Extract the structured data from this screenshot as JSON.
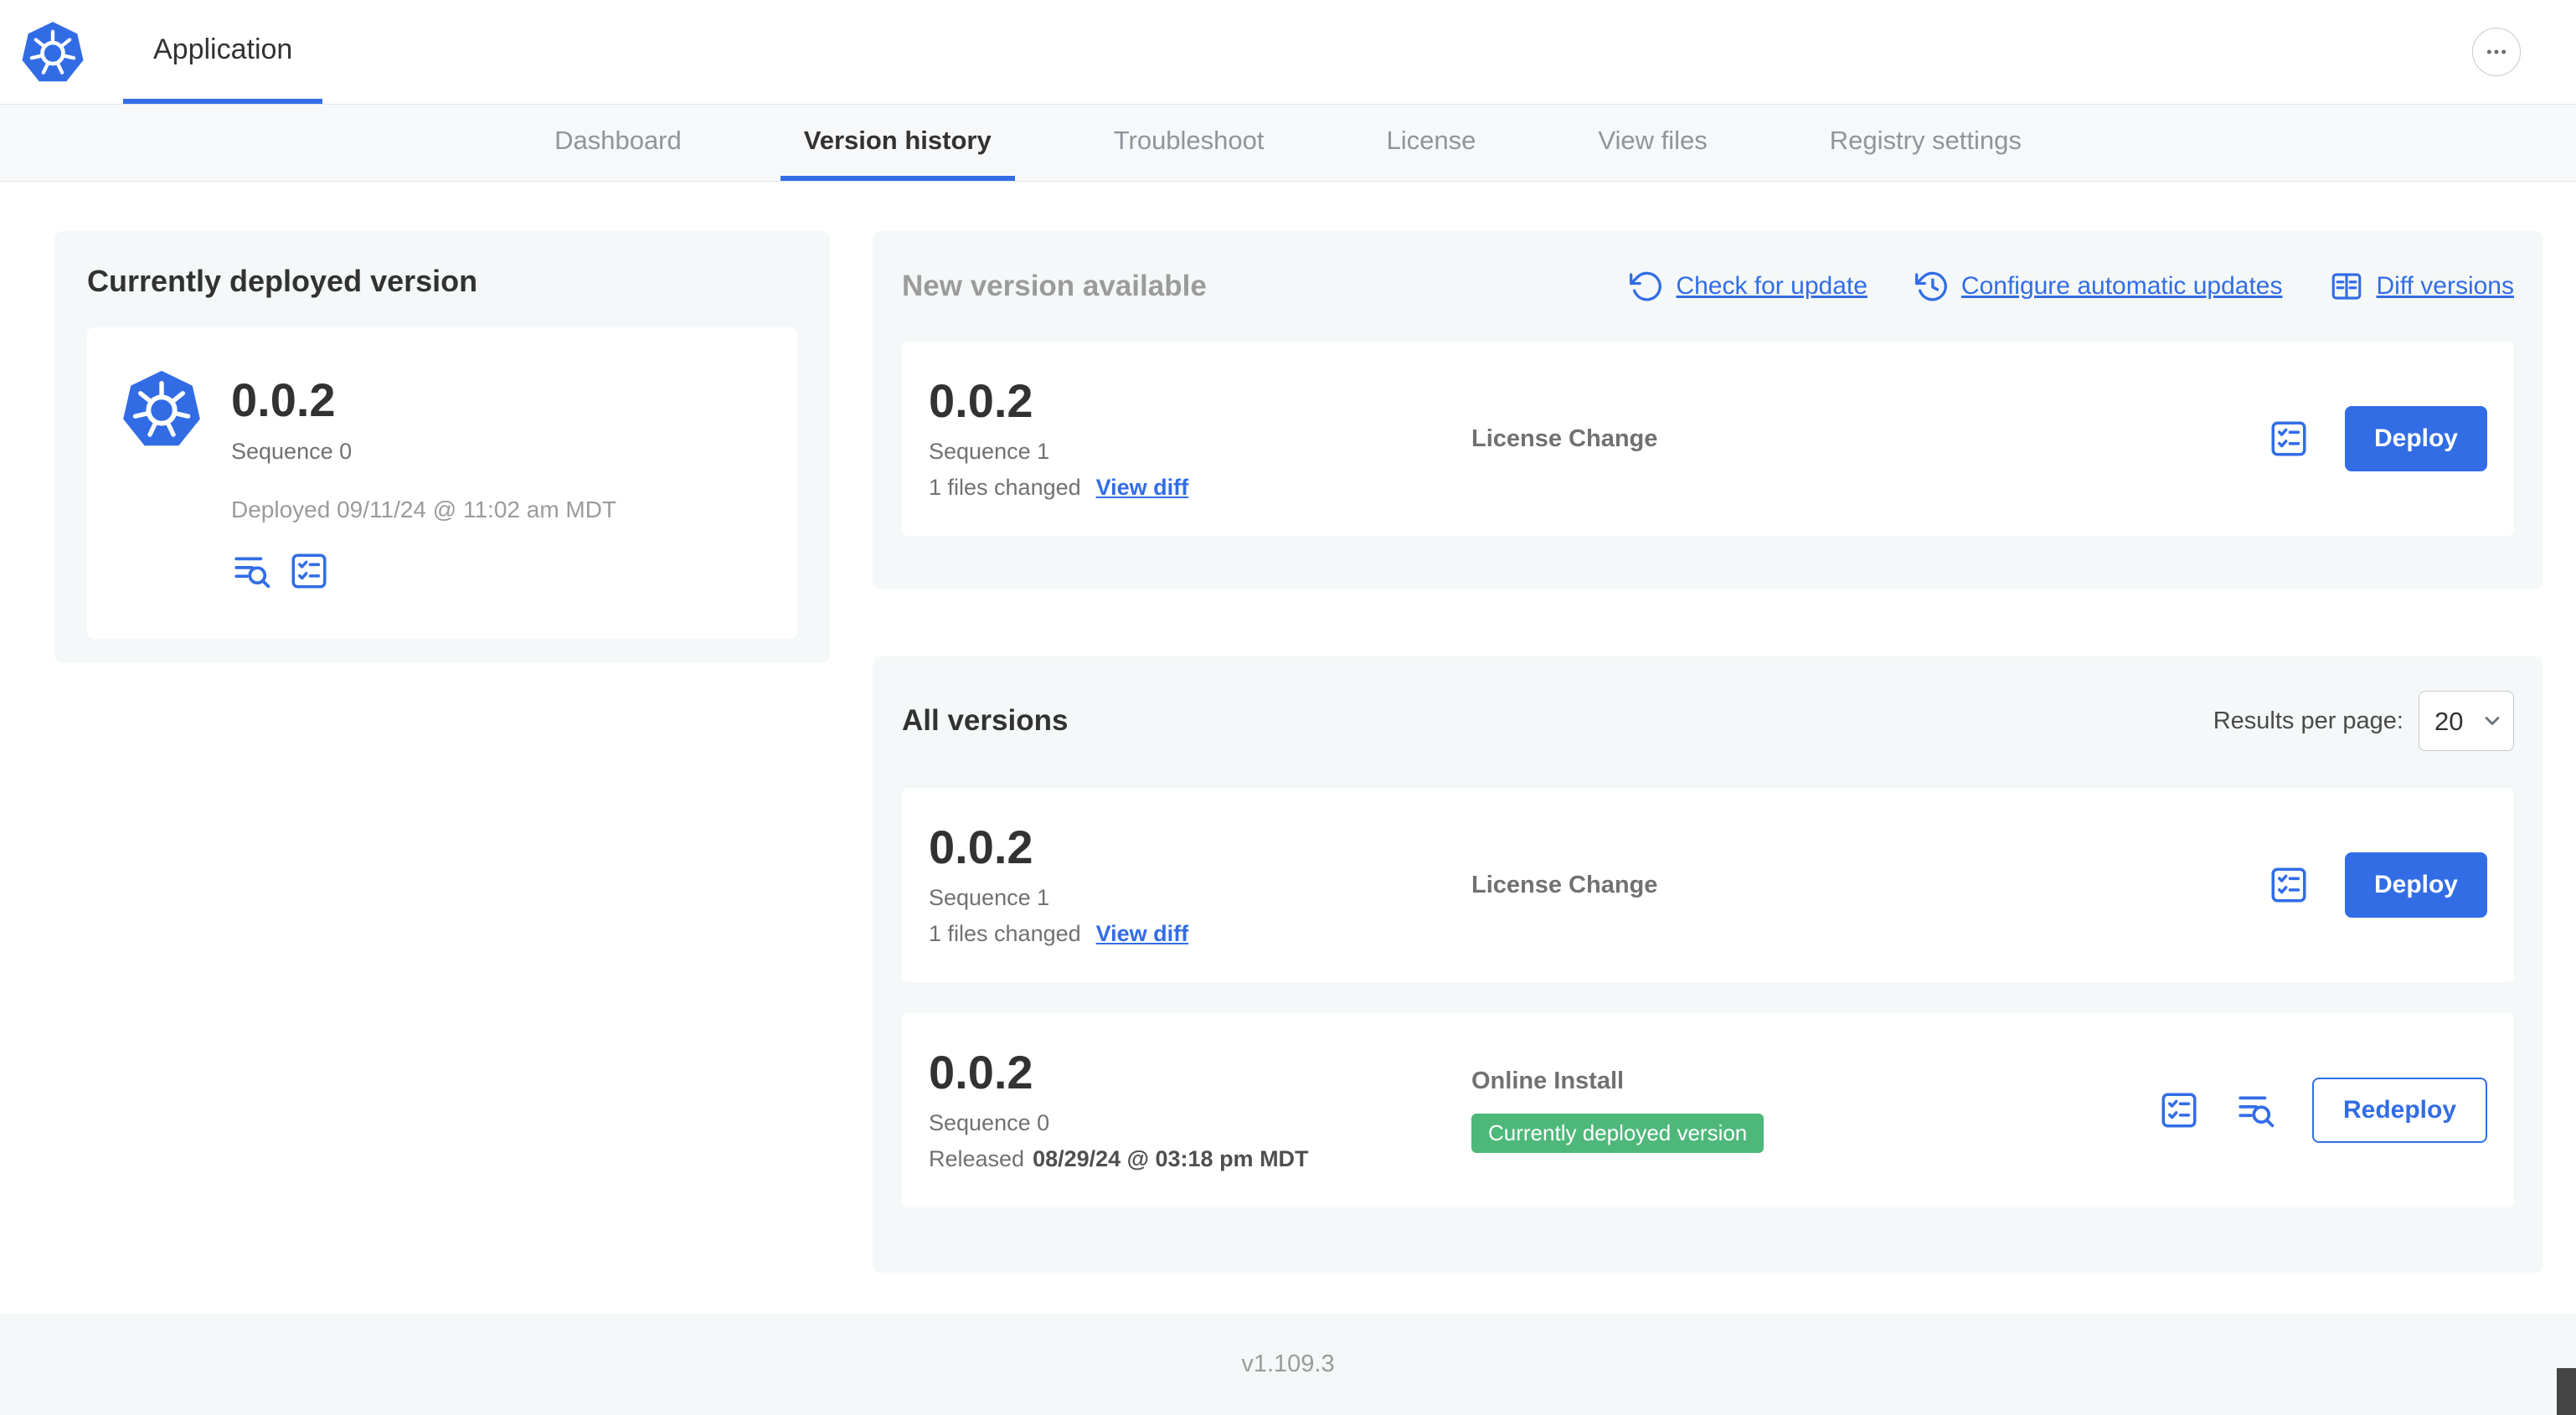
{
  "colors": {
    "accent": "#326de6",
    "k8s_blue": "#326ce5",
    "success_badge": "#4db87a",
    "muted_text": "#9b9b9b",
    "card_background": "#f5f8f9"
  },
  "icons": {
    "app_logo": "kubernetes-heptagon-wheel",
    "more_menu": "ellipsis-in-circle",
    "check_for_update": "rotate-ccw-arrow",
    "configure_automatic_updates": "clock-rotate-arrow",
    "diff_versions": "columns-table",
    "preflight_checks": "checklist-square",
    "release_notes": "lines-with-magnifier",
    "results_select": "chevron-down"
  },
  "header": {
    "app_tab": "Application"
  },
  "nav": {
    "tabs": [
      "Dashboard",
      "Version history",
      "Troubleshoot",
      "License",
      "View files",
      "Registry settings"
    ],
    "active": "Version history"
  },
  "current": {
    "title": "Currently deployed version",
    "version": "0.0.2",
    "sequence": "Sequence 0",
    "deployed": "Deployed 09/11/24 @ 11:02 am MDT"
  },
  "new_version": {
    "title": "New version available",
    "actions": {
      "check_for_update": "Check for update",
      "configure_automatic_updates": "Configure automatic updates",
      "diff_versions": "Diff versions"
    },
    "row": {
      "version": "0.0.2",
      "sequence": "Sequence 1",
      "files_changed": "1 files changed",
      "view_diff": "View diff",
      "source": "License Change",
      "action": "Deploy"
    }
  },
  "all_versions": {
    "title": "All versions",
    "results_per_page_label": "Results per page:",
    "results_per_page_value": "20",
    "rows": [
      {
        "version": "0.0.2",
        "sequence": "Sequence 1",
        "files_changed": "1 files changed",
        "view_diff": "View diff",
        "source": "License Change",
        "action": "Deploy"
      },
      {
        "version": "0.0.2",
        "sequence": "Sequence 0",
        "released_label": "Released",
        "released_date": "08/29/24 @ 03:18 pm MDT",
        "source": "Online Install",
        "badge": "Currently deployed version",
        "action": "Redeploy"
      }
    ]
  },
  "footer": {
    "version": "v1.109.3"
  }
}
